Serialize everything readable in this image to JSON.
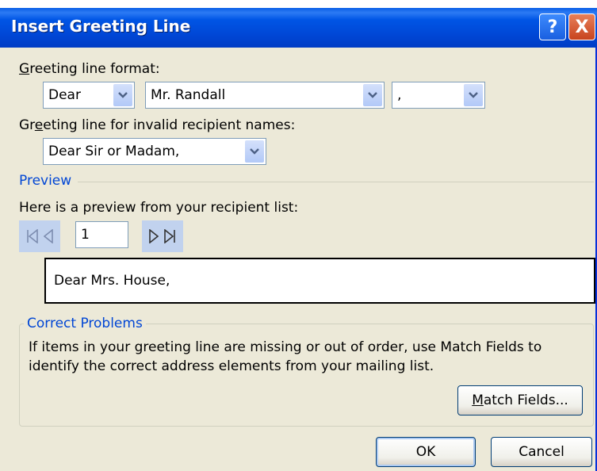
{
  "dialog": {
    "title": "Insert Greeting Line",
    "help_glyph": "?",
    "close_glyph": "X"
  },
  "greeting_format": {
    "label_prefix": "",
    "label_accel": "G",
    "label_rest": "reeting line format:",
    "salutation": "Dear",
    "name_format": "Mr. Randall",
    "punctuation": ","
  },
  "invalid_names": {
    "label_pre": "Gr",
    "label_accel": "e",
    "label_rest": "eting line for invalid recipient names:",
    "value": "Dear Sir or Madam,"
  },
  "preview": {
    "section_title": "Preview",
    "intro": "Here is a preview from your recipient list:",
    "record_number": "1",
    "text": "Dear Mrs. House,"
  },
  "correct_problems": {
    "section_title": "Correct Problems",
    "text": "If items in your greeting line are missing or out of order, use Match Fields to identify the correct address elements from your mailing list.",
    "match_fields_accel": "M",
    "match_fields_rest": "atch Fields..."
  },
  "buttons": {
    "ok": "OK",
    "cancel": "Cancel"
  },
  "colors": {
    "titlebar": "#0055e5",
    "dialog_bg": "#ece9d8",
    "section_title": "#0046d5",
    "nav_bg": "#c1d2ee"
  },
  "icons": {
    "first_record": "first-record-icon",
    "previous_record": "previous-record-icon",
    "next_record": "next-record-icon",
    "last_record": "last-record-icon",
    "dropdown": "chevron-down-icon",
    "help": "help-icon",
    "close": "close-icon"
  }
}
